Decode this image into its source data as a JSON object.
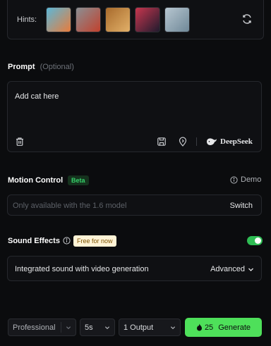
{
  "hints": {
    "label": "Hints:",
    "thumbnails": [
      {
        "name": "hint-thumb-1",
        "colors": [
          "#5bb7d8",
          "#e87c3c"
        ]
      },
      {
        "name": "hint-thumb-2",
        "colors": [
          "#8a8f93",
          "#c2412d"
        ]
      },
      {
        "name": "hint-thumb-3",
        "colors": [
          "#a86b2c",
          "#e2b069"
        ]
      },
      {
        "name": "hint-thumb-4",
        "colors": [
          "#c7364e",
          "#201b2e"
        ]
      },
      {
        "name": "hint-thumb-5",
        "colors": [
          "#b7c6d0",
          "#6f8898"
        ]
      }
    ]
  },
  "prompt": {
    "title": "Prompt",
    "optional": "(Optional)",
    "text": "Add cat here",
    "deepseek_label": "DeepSeek"
  },
  "motion": {
    "title": "Motion Control",
    "badge": "Beta",
    "demo": "Demo",
    "placeholder": "Only available with the 1.6 model",
    "switch": "Switch"
  },
  "sound": {
    "title": "Sound Effects",
    "badge": "Free for now",
    "enabled": true,
    "description": "Integrated sound with video generation",
    "advanced": "Advanced"
  },
  "footer": {
    "mode": "Professional",
    "duration": "5s",
    "outputs": "1 Output",
    "cost": "25",
    "generate": "Generate"
  },
  "colors": {
    "accent": "#4ee05a",
    "background": "#0b0c0e"
  }
}
